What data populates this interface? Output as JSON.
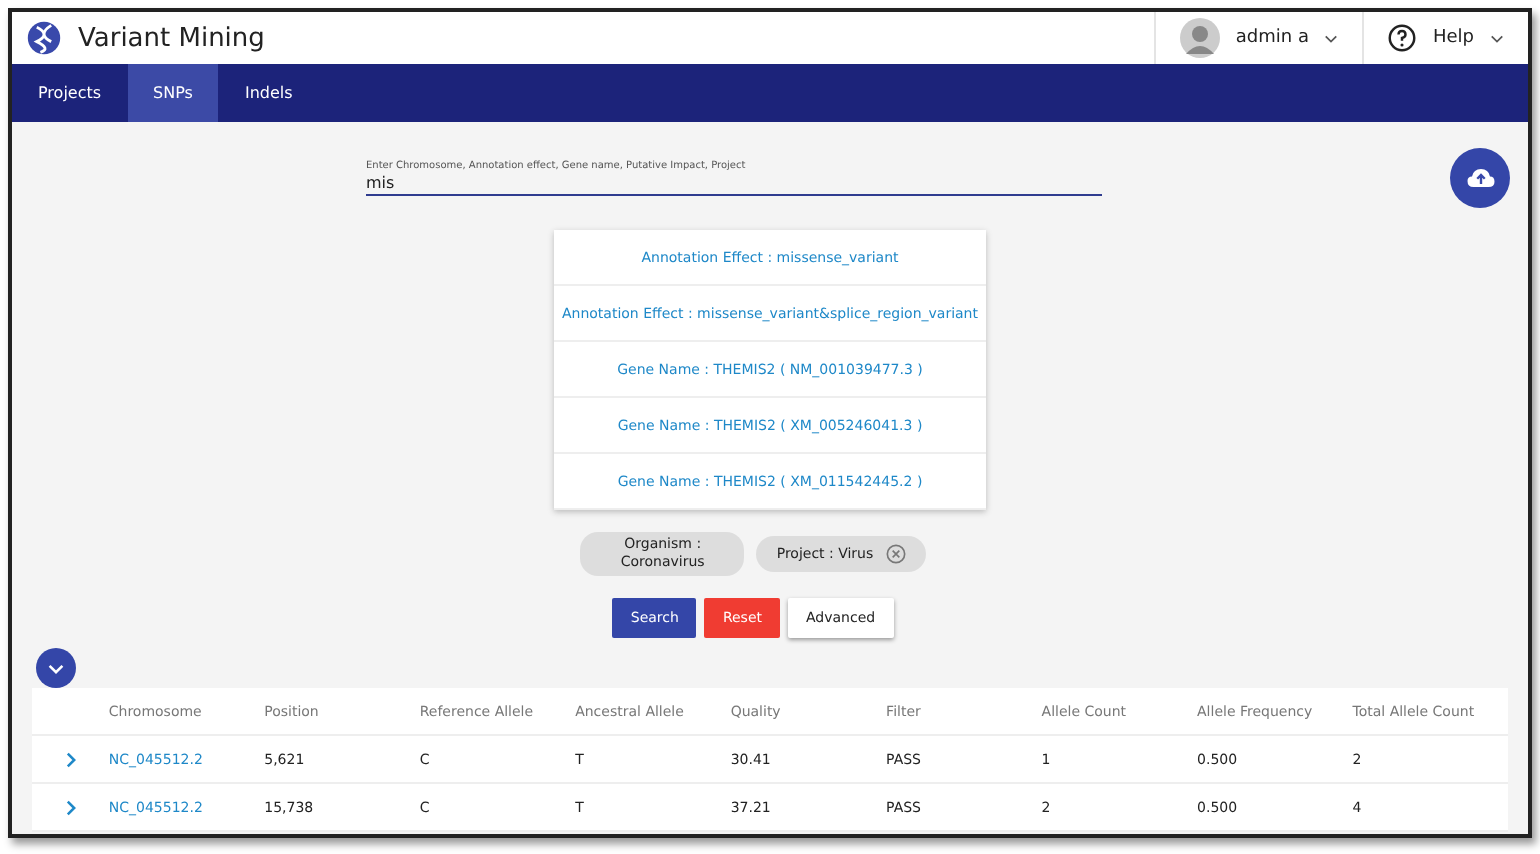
{
  "app": {
    "title": "Variant Mining"
  },
  "user": {
    "name": "admin a"
  },
  "help": {
    "label": "Help"
  },
  "tabs": [
    {
      "label": "Projects",
      "selected": false
    },
    {
      "label": "SNPs",
      "selected": true
    },
    {
      "label": "Indels",
      "selected": false
    }
  ],
  "search": {
    "placeholder": "Enter Chromosome, Annotation effect, Gene name, Putative Impact, Project",
    "value": "mis"
  },
  "suggestions": [
    "Annotation Effect : missense_variant",
    "Annotation Effect : missense_variant&splice_region_variant",
    "Gene Name : THEMIS2 ( NM_001039477.3 )",
    "Gene Name : THEMIS2 ( XM_005246041.3 )",
    "Gene Name : THEMIS2 ( XM_011542445.2 )"
  ],
  "filters": [
    {
      "label": "Organism : Coronavirus",
      "removable": false
    },
    {
      "label": "Project : Virus",
      "removable": true
    }
  ],
  "buttons": [
    {
      "label": "Search",
      "kind": "primary"
    },
    {
      "label": "Reset",
      "kind": "danger"
    },
    {
      "label": "Advanced",
      "kind": "plain"
    }
  ],
  "table": {
    "columns": [
      "Chromosome",
      "Position",
      "Reference Allele",
      "Ancestral Allele",
      "Quality",
      "Filter",
      "Allele Count",
      "Allele Frequency",
      "Total Allele Count"
    ],
    "rows": [
      [
        "NC_045512.2",
        "5,621",
        "C",
        "T",
        "30.41",
        "PASS",
        "1",
        "0.500",
        "2"
      ],
      [
        "NC_045512.2",
        "15,738",
        "C",
        "T",
        "37.21",
        "PASS",
        "2",
        "0.500",
        "4"
      ]
    ]
  }
}
